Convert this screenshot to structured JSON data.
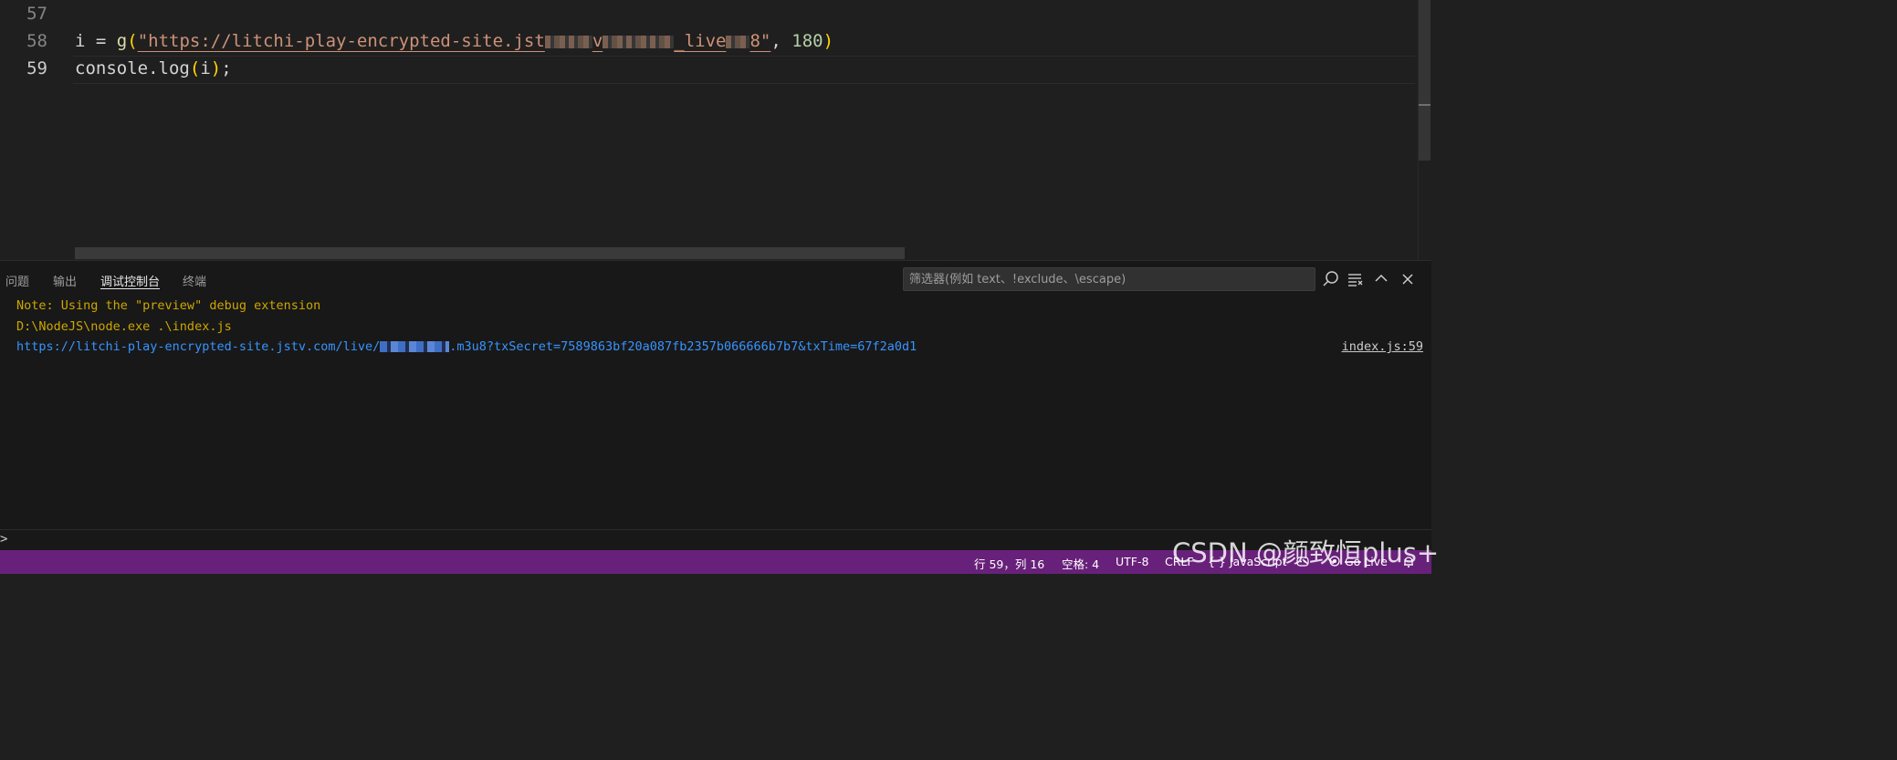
{
  "editor": {
    "line_numbers": [
      "57",
      "58",
      "59"
    ],
    "line58": {
      "var": "i",
      "op": " = ",
      "fn": "g",
      "open_paren": "(",
      "str_start": "\"https://litchi-play-encrypted-site.jst",
      "str_mid1": "v",
      "str_mid2": "_live",
      "str_end": "8\"",
      "comma": ", ",
      "num": "180",
      "close_paren": ")"
    },
    "line59": {
      "obj": "console",
      "dot": ".",
      "method": "log",
      "open": "(",
      "arg": "i",
      "close": ")",
      "semi": ";"
    }
  },
  "panel": {
    "tabs": [
      "问题",
      "输出",
      "调试控制台",
      "终端"
    ],
    "active_tab": "调试控制台",
    "filter_placeholder": "筛选器(例如 text、!exclude、\\escape)",
    "icons": [
      "search-icon",
      "word-wrap-icon",
      "maximize-panel-icon",
      "close-icon"
    ],
    "output": {
      "note": "Note: Using the \"preview\" debug extension",
      "cmd": "D:\\NodeJS\\node.exe .\\index.js",
      "url_start": "https://litchi-play-encrypted-site.jstv.com/live/",
      "url_end": ".m3u8?txSecret=7589863bf20a087fb2357b066666b7b7&txTime=67f2a0d1",
      "source_link": "index.js:59"
    },
    "repl_prompt": ">"
  },
  "statusbar": {
    "position": "行 59，列 16",
    "spaces": "空格: 4",
    "encoding": "UTF-8",
    "eol": "CRLF",
    "language": "{ } JavaScript",
    "golive": "Go Live",
    "bg_color": "#68217a"
  },
  "watermark": "CSDN @颜致恒plus+"
}
